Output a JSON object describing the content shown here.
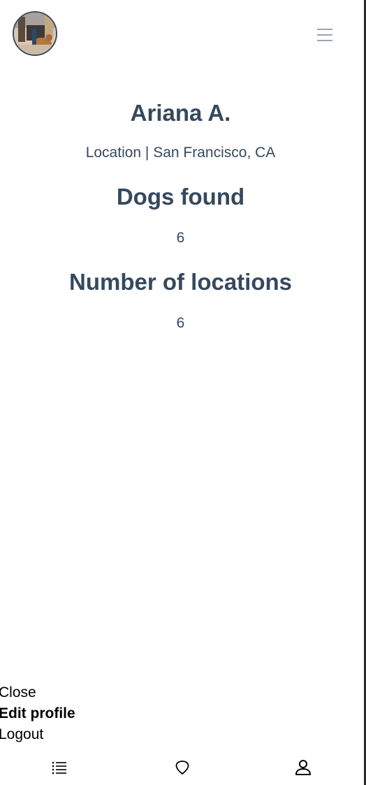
{
  "header": {
    "avatar_alt": "profile photo",
    "menu_icon": "hamburger-menu-icon"
  },
  "profile": {
    "name": "Ariana A.",
    "location": "Location | San Francisco, CA",
    "dogs_found_label": "Dogs found",
    "dogs_found_value": "6",
    "locations_label": "Number of locations",
    "locations_value": "6"
  },
  "menu": {
    "items": [
      {
        "label": "Close"
      },
      {
        "label": "Edit profile"
      },
      {
        "label": "Logout"
      }
    ]
  },
  "bottom_nav": {
    "items": [
      {
        "icon": "list-icon"
      },
      {
        "icon": "map-pin-icon"
      },
      {
        "icon": "user-icon"
      }
    ]
  },
  "colors": {
    "text": "#34495e",
    "menu_text": "#000000",
    "icon_gray": "#9aa5ae"
  }
}
